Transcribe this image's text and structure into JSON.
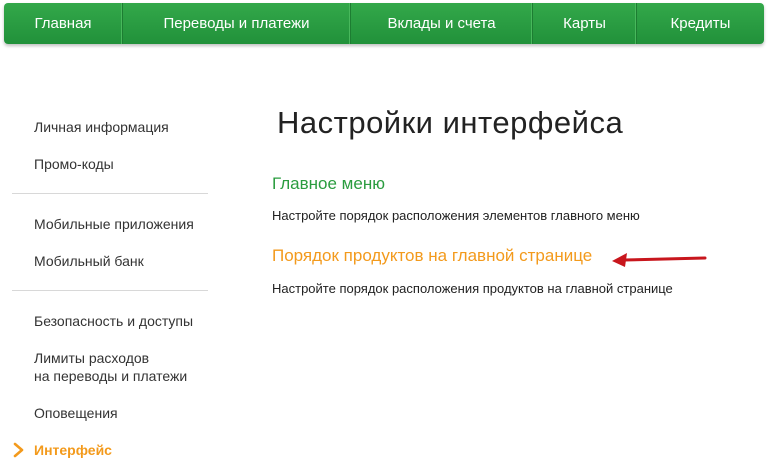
{
  "topnav": {
    "items": [
      {
        "label": "Главная"
      },
      {
        "label": "Переводы и платежи"
      },
      {
        "label": "Вклады и счета"
      },
      {
        "label": "Карты"
      },
      {
        "label": "Кредиты"
      }
    ]
  },
  "sidebar": {
    "group1": [
      "Личная информация",
      "Промо-коды"
    ],
    "group2": [
      "Мобильные приложения",
      "Мобильный банк"
    ],
    "group3": {
      "security": "Безопасность и доступы",
      "limits_line1": "Лимиты расходов",
      "limits_line2": "на переводы и платежи",
      "notifications": "Оповещения",
      "interface": "Интерфейс"
    }
  },
  "main": {
    "title": "Настройки интерфейса",
    "sections": [
      {
        "link": "Главное меню",
        "description": "Настройте порядок расположения элементов главного меню"
      },
      {
        "link": "Порядок продуктов на главной странице",
        "description": "Настройте порядок расположения продуктов на главной странице"
      }
    ]
  },
  "colors": {
    "nav_green": "#2a9c3f",
    "link_green": "#2a9c3f",
    "accent_orange": "#f39a1c",
    "arrow_red": "#c8161d"
  },
  "icons": {
    "active_marker": "chevron-right-icon",
    "annotation": "arrow-left-icon"
  }
}
